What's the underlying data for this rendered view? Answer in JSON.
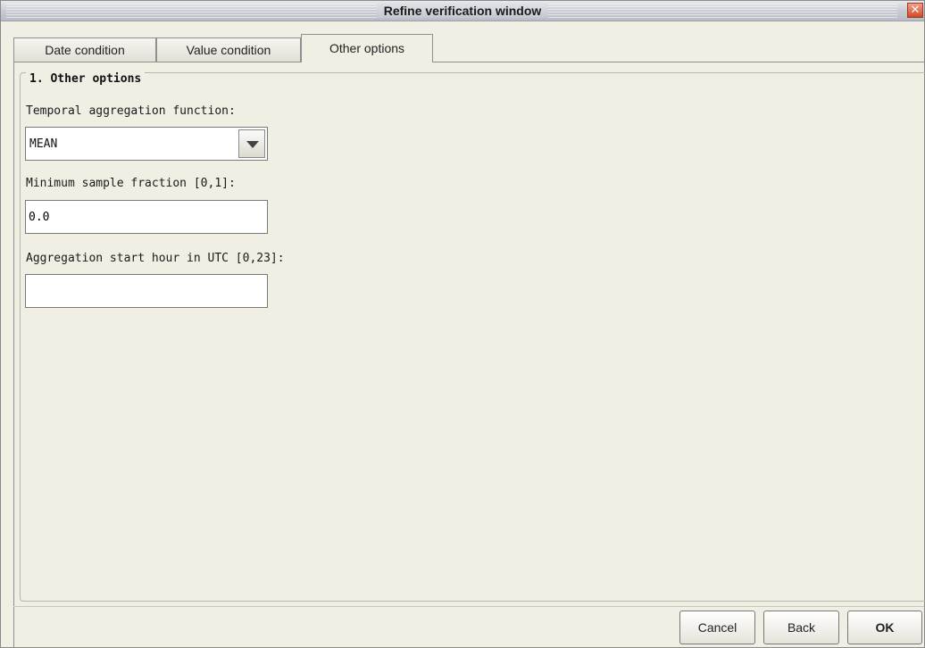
{
  "window": {
    "title": "Refine verification window",
    "close_glyph": "✕"
  },
  "tabs": [
    {
      "label": "Date condition",
      "active": false
    },
    {
      "label": "Value condition",
      "active": false
    },
    {
      "label": "Other options",
      "active": true
    }
  ],
  "group": {
    "title": "1. Other options",
    "aggregation_function": {
      "label": "Temporal aggregation function:",
      "value": "MEAN"
    },
    "min_sample_fraction": {
      "label": "Minimum sample fraction [0,1]:",
      "value": "0.0"
    },
    "start_hour": {
      "label": "Aggregation start hour in UTC [0,23]:",
      "value": ""
    }
  },
  "buttons": {
    "cancel": "Cancel",
    "back": "Back",
    "ok": "OK"
  }
}
